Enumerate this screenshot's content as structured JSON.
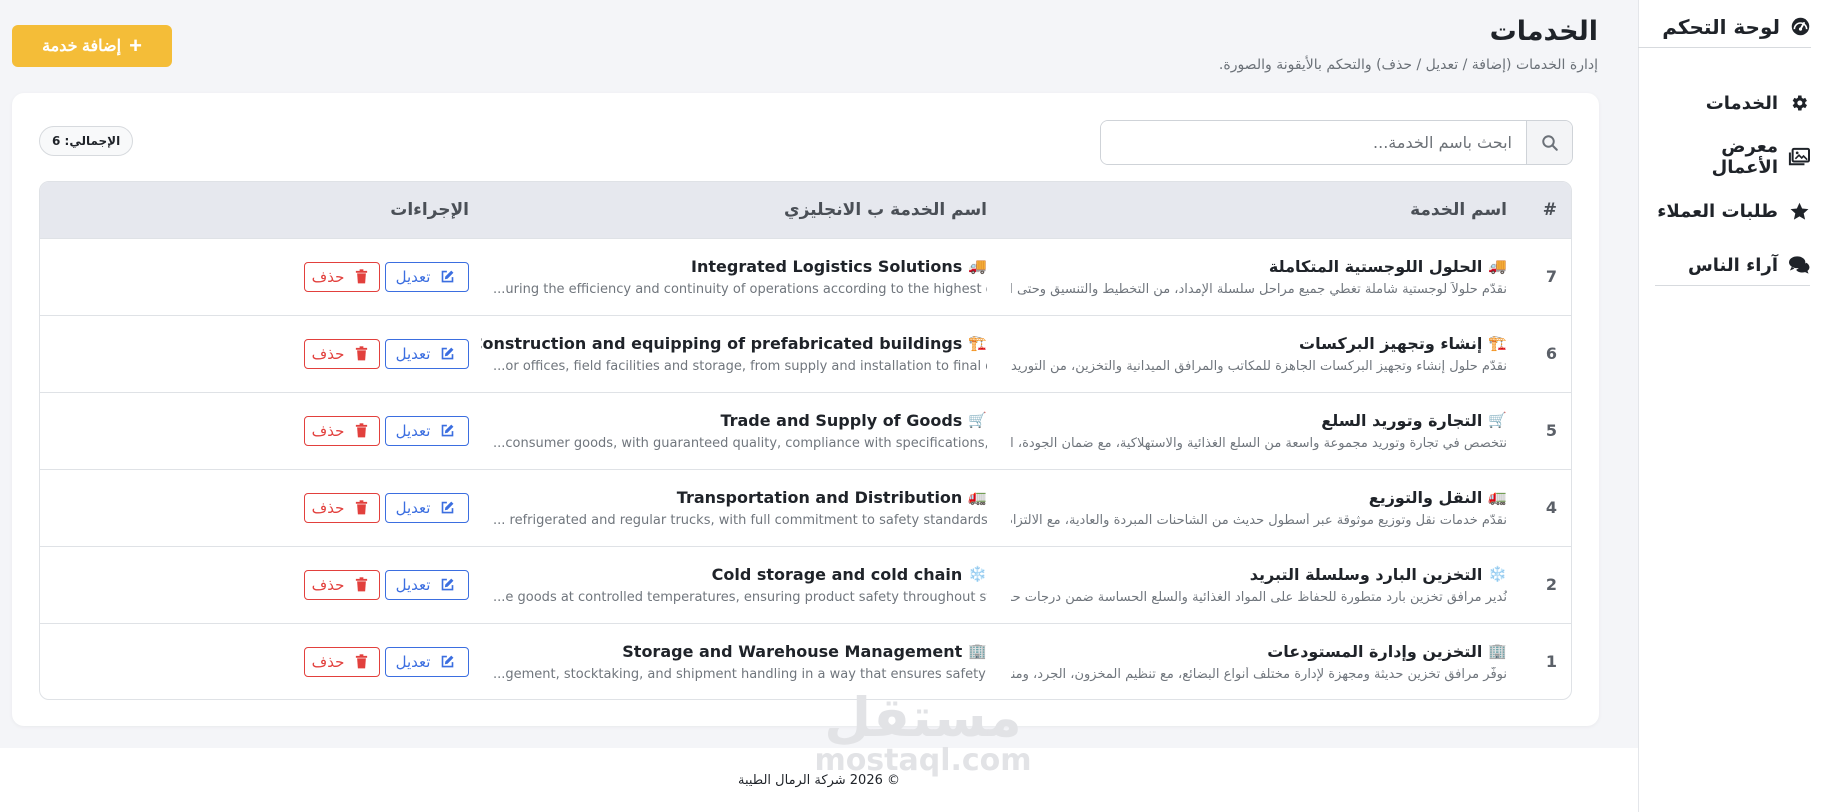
{
  "sidebar": {
    "brand": "لوحة التحكم",
    "items": [
      {
        "label": "الخدمات",
        "icon": "gear-icon"
      },
      {
        "label": "معرض الأعمال",
        "icon": "images-icon"
      },
      {
        "label": "طلبات العملاء",
        "icon": "star-icon"
      },
      {
        "label": "آراء الناس",
        "icon": "comments-icon"
      }
    ]
  },
  "header": {
    "title": "الخدمات",
    "subtitle": "إدارة الخدمات (إضافة / تعديل / حذف) والتحكم بالأيقونة والصورة.",
    "add_button": "إضافة خدمة"
  },
  "search": {
    "placeholder": "ابحث باسم الخدمة..."
  },
  "total_badge": "الإجمالي: 6",
  "table": {
    "columns": {
      "num": "#",
      "name": "اسم الخدمة",
      "name_en": "اسم الخدمة ب الانجليزي",
      "actions": "الإجراءات"
    },
    "edit_label": "تعديل",
    "delete_label": "حذف",
    "rows": [
      {
        "id": "7",
        "emoji": "🚚",
        "name": "الحلول اللوجستية المتكاملة",
        "desc": "نقدّم حلولاً لوجستية شاملة تغطي جميع مراحل سلسلة الإمداد، من التخطيط والتنسيق وحتى التنفيذ ...",
        "name_en": "Integrated Logistics Solutions",
        "desc_en": "...uring the efficiency and continuity of operations according to the highest operational standards"
      },
      {
        "id": "6",
        "emoji": "🏗️",
        "name": "إنشاء وتجهيز البركسات",
        "desc": "نقدّم حلول إنشاء وتجهيز البركسات الجاهزة للمكاتب والمرافق الميدانية والتخزين، من التوريد والتركي...",
        "name_en": "Construction and equipping of prefabricated buildings",
        "desc_en": "...or offices, field facilities and storage, from supply and installation to final delivery ready for use"
      },
      {
        "id": "5",
        "emoji": "🛒",
        "name": "التجارة وتوريد السلع",
        "desc": "نتخصص في تجارة وتوريد مجموعة واسعة من السلع الغذائية والاستهلاكية، مع ضمان الجودة، الالتزا...",
        "name_en": "Trade and Supply of Goods",
        "desc_en": "...consumer goods, with guaranteed quality, compliance with specifications, and on-time delivery"
      },
      {
        "id": "4",
        "emoji": "🚛",
        "name": "النقل والتوزيع",
        "desc": "نقدّم خدمات نقل وتوزيع موثوقة عبر أسطول حديث من الشاحنات المبردة والعادية، مع الالتزام الكام...",
        "name_en": "Transportation and Distribution",
        "desc_en": "... refrigerated and regular trucks, with full commitment to safety standards and on-time delivery"
      },
      {
        "id": "2",
        "emoji": "❄️",
        "name": "التخزين البارد وسلسلة التبريد",
        "desc": "نُدير مرافق تخزين بارد متطورة للحفاظ على المواد الغذائية والسلع الحساسة ضمن درجات حرارة مضبو...",
        "name_en": "Cold storage and cold chain",
        "desc_en": "...e goods at controlled temperatures, ensuring product safety throughout storage and transport"
      },
      {
        "id": "1",
        "emoji": "🏢",
        "name": "التخزين وإدارة المستودعات",
        "desc": "نوفّر مرافق تخزين حديثة ومجهزة لإدارة مختلف أنواع البضائع، مع تنظيم المخزون، الجرد، ومناولة الش...",
        "name_en": "Storage and Warehouse Management",
        "desc_en": "...gement, stocktaking, and shipment handling in a way that ensures safety and maintains quality"
      }
    ]
  },
  "watermark": {
    "arabic": "مستقل",
    "latin": "mostaql.com"
  },
  "footer": "© 2026 شركة الرمال الطيبة",
  "colors": {
    "accent": "#f4bd38",
    "edit": "#3b6ee0",
    "delete": "#e2403d",
    "background": "#f4f5f8"
  }
}
